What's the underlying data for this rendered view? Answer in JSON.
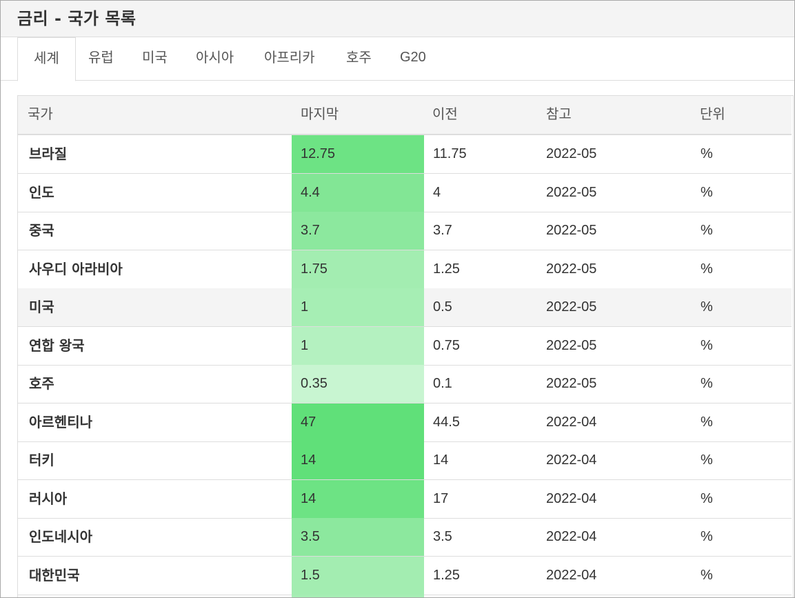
{
  "page": {
    "title": "금리 - 국가 목록"
  },
  "tabs": [
    {
      "label": "세계",
      "active": true
    },
    {
      "label": "유럽",
      "active": false
    },
    {
      "label": "미국",
      "active": false
    },
    {
      "label": "아시아",
      "active": false
    },
    {
      "label": "아프리카",
      "active": false
    },
    {
      "label": "호주",
      "active": false
    },
    {
      "label": "G20",
      "active": false
    }
  ],
  "table": {
    "headers": {
      "country": "국가",
      "last": "마지막",
      "previous": "이전",
      "reference": "참고",
      "unit": "단위"
    },
    "rows": [
      {
        "country": "브라질",
        "last": "12.75",
        "previous": "11.75",
        "reference": "2022-05",
        "unit": "%",
        "heat": "#6de384"
      },
      {
        "country": "인도",
        "last": "4.4",
        "previous": "4",
        "reference": "2022-05",
        "unit": "%",
        "heat": "#82e695"
      },
      {
        "country": "중국",
        "last": "3.7",
        "previous": "3.7",
        "reference": "2022-05",
        "unit": "%",
        "heat": "#8ce89e"
      },
      {
        "country": "사우디 아라비아",
        "last": "1.75",
        "previous": "1.25",
        "reference": "2022-05",
        "unit": "%",
        "heat": "#a3edb1"
      },
      {
        "country": "미국",
        "last": "1",
        "previous": "0.5",
        "reference": "2022-05",
        "unit": "%",
        "heat": "#a6eeb4"
      },
      {
        "country": "연합 왕국",
        "last": "1",
        "previous": "0.75",
        "reference": "2022-05",
        "unit": "%",
        "heat": "#b4f1c0"
      },
      {
        "country": "호주",
        "last": "0.35",
        "previous": "0.1",
        "reference": "2022-05",
        "unit": "%",
        "heat": "#c8f5d1"
      },
      {
        "country": "아르헨티나",
        "last": "47",
        "previous": "44.5",
        "reference": "2022-04",
        "unit": "%",
        "heat": "#60e079"
      },
      {
        "country": "터키",
        "last": "14",
        "previous": "14",
        "reference": "2022-04",
        "unit": "%",
        "heat": "#60e079"
      },
      {
        "country": "러시아",
        "last": "14",
        "previous": "17",
        "reference": "2022-04",
        "unit": "%",
        "heat": "#6de384"
      },
      {
        "country": "인도네시아",
        "last": "3.5",
        "previous": "3.5",
        "reference": "2022-04",
        "unit": "%",
        "heat": "#8ce89e"
      },
      {
        "country": "대한민국",
        "last": "1.5",
        "previous": "1.25",
        "reference": "2022-04",
        "unit": "%",
        "heat": "#a3edb1"
      }
    ]
  }
}
